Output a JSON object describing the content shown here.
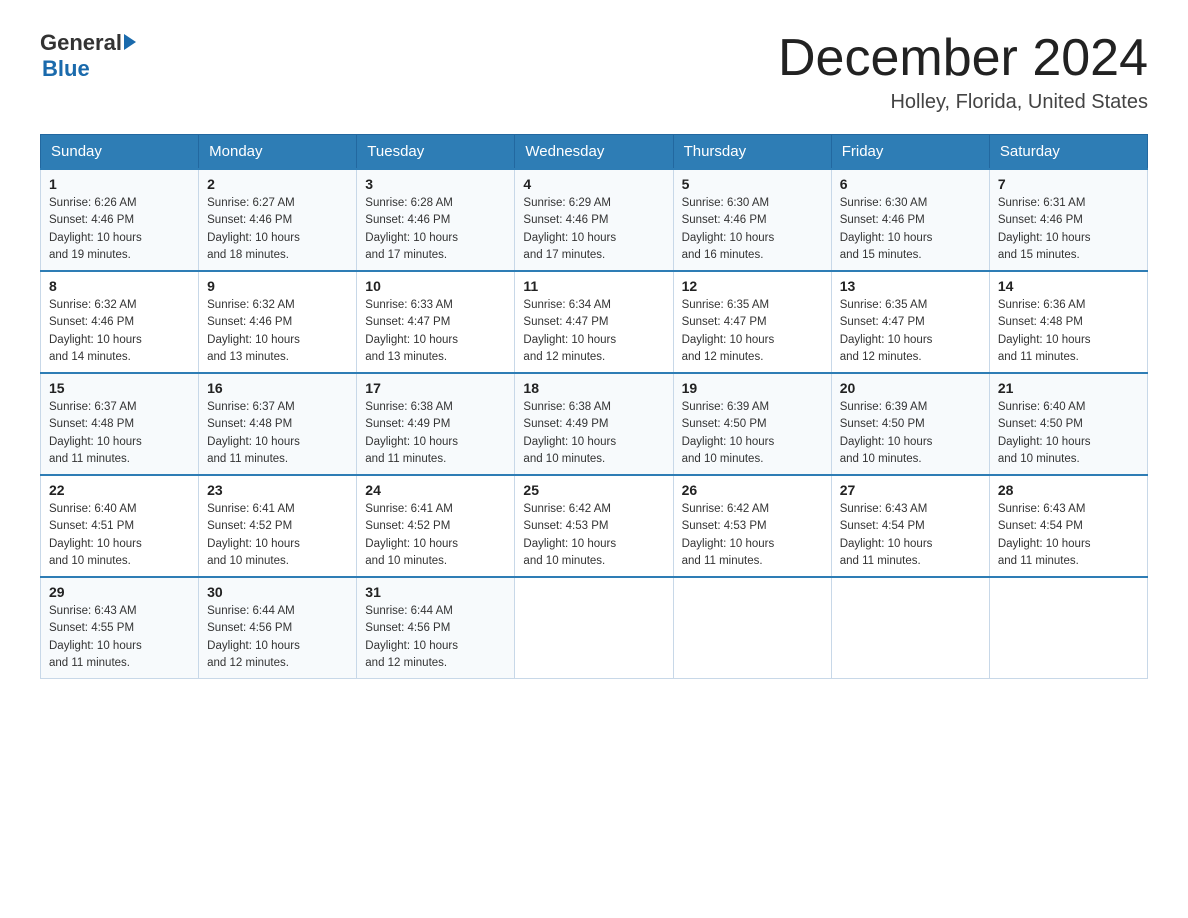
{
  "header": {
    "logo_general": "General",
    "logo_blue": "Blue",
    "month_title": "December 2024",
    "location": "Holley, Florida, United States"
  },
  "days_of_week": [
    "Sunday",
    "Monday",
    "Tuesday",
    "Wednesday",
    "Thursday",
    "Friday",
    "Saturday"
  ],
  "weeks": [
    [
      {
        "day": "1",
        "sunrise": "6:26 AM",
        "sunset": "4:46 PM",
        "daylight": "10 hours and 19 minutes."
      },
      {
        "day": "2",
        "sunrise": "6:27 AM",
        "sunset": "4:46 PM",
        "daylight": "10 hours and 18 minutes."
      },
      {
        "day": "3",
        "sunrise": "6:28 AM",
        "sunset": "4:46 PM",
        "daylight": "10 hours and 17 minutes."
      },
      {
        "day": "4",
        "sunrise": "6:29 AM",
        "sunset": "4:46 PM",
        "daylight": "10 hours and 17 minutes."
      },
      {
        "day": "5",
        "sunrise": "6:30 AM",
        "sunset": "4:46 PM",
        "daylight": "10 hours and 16 minutes."
      },
      {
        "day": "6",
        "sunrise": "6:30 AM",
        "sunset": "4:46 PM",
        "daylight": "10 hours and 15 minutes."
      },
      {
        "day": "7",
        "sunrise": "6:31 AM",
        "sunset": "4:46 PM",
        "daylight": "10 hours and 15 minutes."
      }
    ],
    [
      {
        "day": "8",
        "sunrise": "6:32 AM",
        "sunset": "4:46 PM",
        "daylight": "10 hours and 14 minutes."
      },
      {
        "day": "9",
        "sunrise": "6:32 AM",
        "sunset": "4:46 PM",
        "daylight": "10 hours and 13 minutes."
      },
      {
        "day": "10",
        "sunrise": "6:33 AM",
        "sunset": "4:47 PM",
        "daylight": "10 hours and 13 minutes."
      },
      {
        "day": "11",
        "sunrise": "6:34 AM",
        "sunset": "4:47 PM",
        "daylight": "10 hours and 12 minutes."
      },
      {
        "day": "12",
        "sunrise": "6:35 AM",
        "sunset": "4:47 PM",
        "daylight": "10 hours and 12 minutes."
      },
      {
        "day": "13",
        "sunrise": "6:35 AM",
        "sunset": "4:47 PM",
        "daylight": "10 hours and 12 minutes."
      },
      {
        "day": "14",
        "sunrise": "6:36 AM",
        "sunset": "4:48 PM",
        "daylight": "10 hours and 11 minutes."
      }
    ],
    [
      {
        "day": "15",
        "sunrise": "6:37 AM",
        "sunset": "4:48 PM",
        "daylight": "10 hours and 11 minutes."
      },
      {
        "day": "16",
        "sunrise": "6:37 AM",
        "sunset": "4:48 PM",
        "daylight": "10 hours and 11 minutes."
      },
      {
        "day": "17",
        "sunrise": "6:38 AM",
        "sunset": "4:49 PM",
        "daylight": "10 hours and 11 minutes."
      },
      {
        "day": "18",
        "sunrise": "6:38 AM",
        "sunset": "4:49 PM",
        "daylight": "10 hours and 10 minutes."
      },
      {
        "day": "19",
        "sunrise": "6:39 AM",
        "sunset": "4:50 PM",
        "daylight": "10 hours and 10 minutes."
      },
      {
        "day": "20",
        "sunrise": "6:39 AM",
        "sunset": "4:50 PM",
        "daylight": "10 hours and 10 minutes."
      },
      {
        "day": "21",
        "sunrise": "6:40 AM",
        "sunset": "4:50 PM",
        "daylight": "10 hours and 10 minutes."
      }
    ],
    [
      {
        "day": "22",
        "sunrise": "6:40 AM",
        "sunset": "4:51 PM",
        "daylight": "10 hours and 10 minutes."
      },
      {
        "day": "23",
        "sunrise": "6:41 AM",
        "sunset": "4:52 PM",
        "daylight": "10 hours and 10 minutes."
      },
      {
        "day": "24",
        "sunrise": "6:41 AM",
        "sunset": "4:52 PM",
        "daylight": "10 hours and 10 minutes."
      },
      {
        "day": "25",
        "sunrise": "6:42 AM",
        "sunset": "4:53 PM",
        "daylight": "10 hours and 10 minutes."
      },
      {
        "day": "26",
        "sunrise": "6:42 AM",
        "sunset": "4:53 PM",
        "daylight": "10 hours and 11 minutes."
      },
      {
        "day": "27",
        "sunrise": "6:43 AM",
        "sunset": "4:54 PM",
        "daylight": "10 hours and 11 minutes."
      },
      {
        "day": "28",
        "sunrise": "6:43 AM",
        "sunset": "4:54 PM",
        "daylight": "10 hours and 11 minutes."
      }
    ],
    [
      {
        "day": "29",
        "sunrise": "6:43 AM",
        "sunset": "4:55 PM",
        "daylight": "10 hours and 11 minutes."
      },
      {
        "day": "30",
        "sunrise": "6:44 AM",
        "sunset": "4:56 PM",
        "daylight": "10 hours and 12 minutes."
      },
      {
        "day": "31",
        "sunrise": "6:44 AM",
        "sunset": "4:56 PM",
        "daylight": "10 hours and 12 minutes."
      },
      null,
      null,
      null,
      null
    ]
  ],
  "labels": {
    "sunrise": "Sunrise:",
    "sunset": "Sunset:",
    "daylight": "Daylight:"
  }
}
